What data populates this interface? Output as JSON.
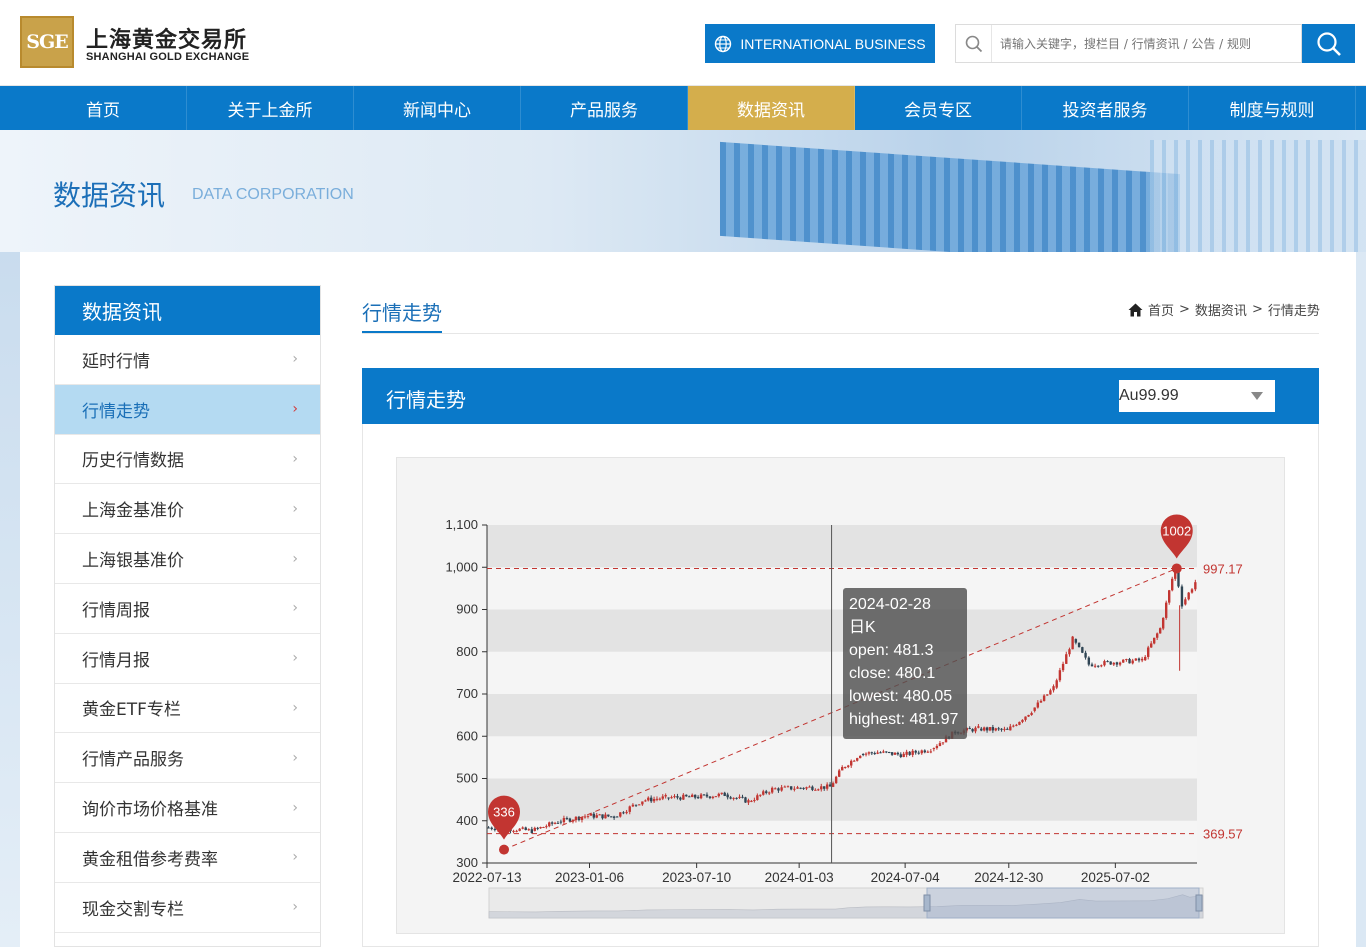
{
  "header": {
    "logo_cn": "上海黄金交易所",
    "logo_en": "SHANGHAI GOLD EXCHANGE",
    "logo_mark": "SGE",
    "intl_button": "INTERNATIONAL BUSINESS",
    "search_placeholder": "请输入关键字，搜栏目 / 行情资讯 / 公告 / 规则"
  },
  "nav": [
    {
      "label": "首页"
    },
    {
      "label": "关于上金所"
    },
    {
      "label": "新闻中心"
    },
    {
      "label": "产品服务"
    },
    {
      "label": "数据资讯",
      "active": true
    },
    {
      "label": "会员专区"
    },
    {
      "label": "投资者服务"
    },
    {
      "label": "制度与规则"
    }
  ],
  "banner": {
    "title": "数据资讯",
    "subtitle": "DATA CORPORATION"
  },
  "sidebar": {
    "heading": "数据资讯",
    "items": [
      {
        "label": "延时行情"
      },
      {
        "label": "行情走势",
        "active": true
      },
      {
        "label": "历史行情数据"
      },
      {
        "label": "上海金基准价"
      },
      {
        "label": "上海银基准价"
      },
      {
        "label": "行情周报"
      },
      {
        "label": "行情月报"
      },
      {
        "label": "黄金ETF专栏"
      },
      {
        "label": "行情产品服务"
      },
      {
        "label": "询价市场价格基准"
      },
      {
        "label": "黄金租借参考费率"
      },
      {
        "label": "现金交割专栏"
      }
    ]
  },
  "section": {
    "title": "行情走势",
    "breadcrumb": [
      "首页",
      "数据资讯",
      "行情走势"
    ],
    "breadcrumb_sep": ">"
  },
  "panel": {
    "title": "行情走势",
    "selected_product": "Au99.99"
  },
  "tooltip": {
    "date": "2024-02-28",
    "kind": "日K",
    "open": "open: 481.3",
    "close": "close: 480.1",
    "lowest": "lowest: 480.05",
    "highest": "highest: 481.97"
  },
  "colors": {
    "brand_blue": "#0a79c9",
    "nav_active": "#d4ae4c",
    "up_red": "#c23531",
    "down_dark": "#2f4554"
  },
  "chart_data": {
    "type": "candlestick",
    "x_ticks": [
      "2022-07-13",
      "2023-01-06",
      "2023-07-10",
      "2024-01-03",
      "2024-07-04",
      "2024-12-30",
      "2025-07-02"
    ],
    "y_ticks": [
      "300",
      "400",
      "500",
      "600",
      "700",
      "800",
      "900",
      "1,000",
      "1,100"
    ],
    "ylim": [
      300,
      1100
    ],
    "x_range": [
      "2022-07-13",
      "2025-11-20"
    ],
    "series": [
      {
        "name": "日K",
        "points": [
          [
            "2022-07-13",
            384
          ],
          [
            "2022-08-20",
            382
          ],
          [
            "2022-10-01",
            376
          ],
          [
            "2022-11-15",
            398
          ],
          [
            "2023-01-06",
            412
          ],
          [
            "2023-02-20",
            410
          ],
          [
            "2023-04-10",
            448
          ],
          [
            "2023-05-20",
            455
          ],
          [
            "2023-07-10",
            456
          ],
          [
            "2023-08-30",
            462
          ],
          [
            "2023-10-10",
            446
          ],
          [
            "2023-11-20",
            475
          ],
          [
            "2024-01-03",
            478
          ],
          [
            "2024-02-28",
            480.1
          ],
          [
            "2024-03-20",
            525
          ],
          [
            "2024-04-20",
            558
          ],
          [
            "2024-05-20",
            562
          ],
          [
            "2024-07-04",
            556
          ],
          [
            "2024-08-20",
            570
          ],
          [
            "2024-10-01",
            610
          ],
          [
            "2024-11-10",
            618
          ],
          [
            "2024-12-30",
            614
          ],
          [
            "2025-02-10",
            660
          ],
          [
            "2025-03-20",
            715
          ],
          [
            "2025-04-22",
            830
          ],
          [
            "2025-05-20",
            770
          ],
          [
            "2025-07-02",
            775
          ],
          [
            "2025-08-20",
            780
          ],
          [
            "2025-09-20",
            855
          ],
          [
            "2025-10-16",
            1002
          ],
          [
            "2025-10-28",
            912
          ],
          [
            "2025-11-20",
            965
          ]
        ]
      }
    ],
    "mark_points": [
      {
        "label": "1002",
        "type": "max",
        "date": "2025-10-16",
        "value": 997.17
      },
      {
        "label": "336",
        "type": "min",
        "date": "2022-07-13",
        "value": 369.57
      }
    ],
    "mark_lines": [
      {
        "label": "997.17",
        "value": 997.17
      },
      {
        "label": "369.57",
        "value": 369.57
      }
    ],
    "crosshair_date": "2024-02-28",
    "grid": true,
    "datazoom": true
  }
}
